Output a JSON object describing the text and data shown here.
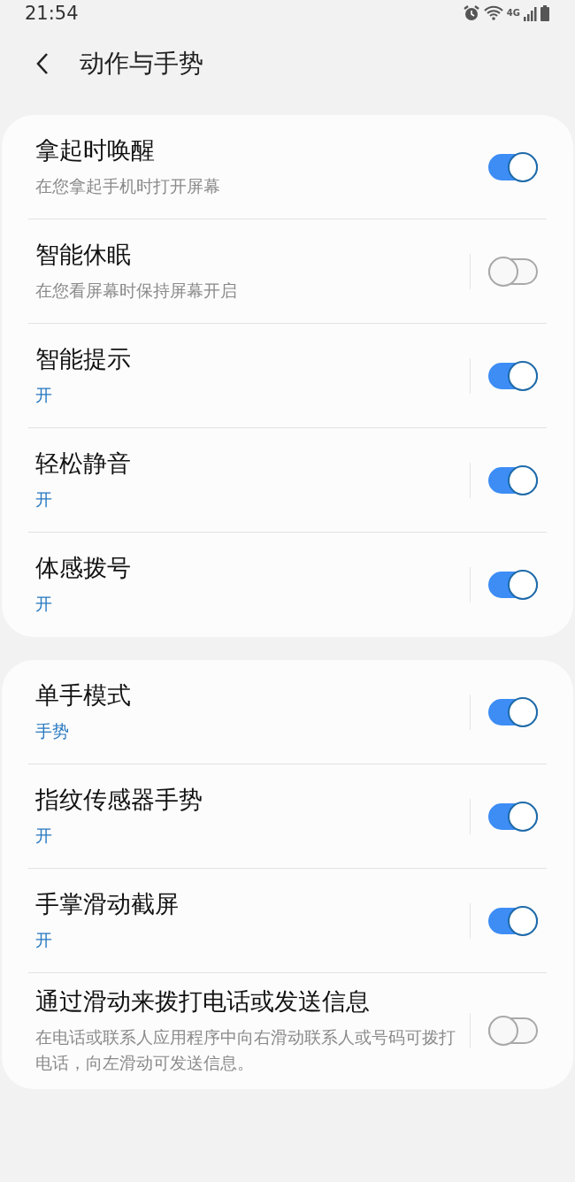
{
  "status_bar": {
    "time": "21:54",
    "network": "4G"
  },
  "header": {
    "title": "动作与手势"
  },
  "groups": [
    {
      "items": [
        {
          "title": "拿起时唤醒",
          "subtitle": "在您拿起手机时打开屏幕",
          "kind": "description",
          "on": true,
          "split": false
        },
        {
          "title": "智能休眠",
          "subtitle": "在您看屏幕时保持屏幕开启",
          "kind": "description",
          "on": false,
          "split": true
        },
        {
          "title": "智能提示",
          "subtitle": "开",
          "kind": "status",
          "on": true,
          "split": true
        },
        {
          "title": "轻松静音",
          "subtitle": "开",
          "kind": "status",
          "on": true,
          "split": true
        },
        {
          "title": "体感拨号",
          "subtitle": "开",
          "kind": "status",
          "on": true,
          "split": true
        }
      ]
    },
    {
      "items": [
        {
          "title": "单手模式",
          "subtitle": "手势",
          "kind": "status",
          "on": true,
          "split": true
        },
        {
          "title": "指纹传感器手势",
          "subtitle": "开",
          "kind": "status",
          "on": true,
          "split": true
        },
        {
          "title": "手掌滑动截屏",
          "subtitle": "开",
          "kind": "status",
          "on": true,
          "split": true
        },
        {
          "title": "通过滑动来拨打电话或发送信息",
          "subtitle": "在电话或联系人应用程序中向右滑动联系人或号码可拨打电话，向左滑动可发送信息。",
          "kind": "description",
          "on": false,
          "split": true
        }
      ]
    }
  ]
}
